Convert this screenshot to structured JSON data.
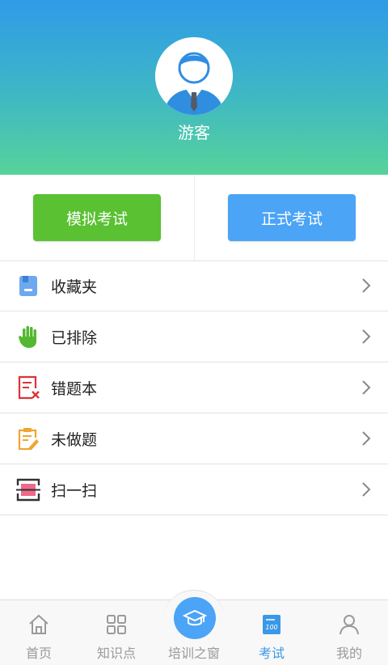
{
  "profile": {
    "username": "游客"
  },
  "exam_buttons": {
    "mock": "模拟考试",
    "formal": "正式考试"
  },
  "menu": {
    "items": [
      {
        "label": "收藏夹",
        "icon": "bookmark-folder-icon"
      },
      {
        "label": "已排除",
        "icon": "hand-stop-icon"
      },
      {
        "label": "错题本",
        "icon": "wrong-answer-book-icon"
      },
      {
        "label": "未做题",
        "icon": "clipboard-edit-icon"
      },
      {
        "label": "扫一扫",
        "icon": "scan-icon"
      }
    ]
  },
  "tabbar": {
    "tabs": [
      {
        "label": "首页",
        "icon": "home-icon",
        "active": false
      },
      {
        "label": "知识点",
        "icon": "grid-icon",
        "active": false
      },
      {
        "label": "培训之窗",
        "icon": "graduation-cap-icon",
        "active": false
      },
      {
        "label": "考试",
        "icon": "exam-100-icon",
        "active": true
      },
      {
        "label": "我的",
        "icon": "person-icon",
        "active": false
      }
    ]
  },
  "colors": {
    "header_top": "#2f9be8",
    "header_bottom": "#56d39a",
    "mock_button": "#5ac133",
    "formal_button": "#4ba4f6",
    "active_tab": "#3a98e8",
    "inactive_tab": "#9a9a9a"
  }
}
